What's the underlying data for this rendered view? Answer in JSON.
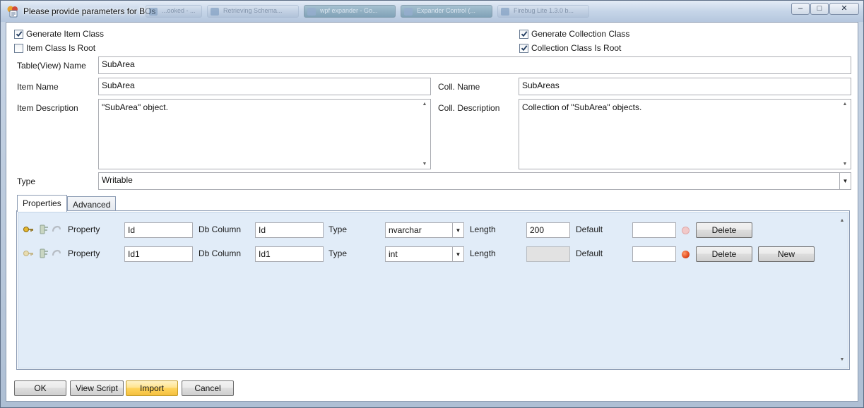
{
  "window": {
    "title": "Please provide parameters for BOs",
    "background_tabs": [
      "...ooked - ...",
      "Retrieving Schema...",
      "wpf expander - Go...",
      "Expander Control (...",
      "Firebug Lite 1.3.0 b..."
    ],
    "minimize": "–",
    "maximize": "□",
    "close": "✕"
  },
  "options": {
    "generate_item_class": {
      "label": "Generate Item Class",
      "checked": true
    },
    "item_class_is_root": {
      "label": "Item Class Is Root",
      "checked": false
    },
    "generate_collection_class": {
      "label": "Generate Collection Class",
      "checked": true
    },
    "collection_class_is_root": {
      "label": "Collection Class Is Root",
      "checked": true
    }
  },
  "form": {
    "table_name_label": "Table(View) Name",
    "table_name_value": "SubArea",
    "item_name_label": "Item Name",
    "item_name_value": "SubArea",
    "coll_name_label": "Coll. Name",
    "coll_name_value": "SubAreas",
    "item_description_label": "Item Description",
    "item_description_value": "\"SubArea\" object.",
    "coll_description_label": "Coll. Description",
    "coll_description_value": "Collection of \"SubArea\" objects.",
    "type_label": "Type",
    "type_value": "Writable"
  },
  "tabs": [
    {
      "label": "Properties",
      "active": true
    },
    {
      "label": "Advanced",
      "active": false
    }
  ],
  "properties_rows": [
    {
      "property_label": "Property",
      "property_value": "Id",
      "db_column_label": "Db Column",
      "db_column_value": "Id",
      "type_label": "Type",
      "type_value": "nvarchar",
      "length_label": "Length",
      "length_value": "200",
      "length_enabled": true,
      "default_label": "Default",
      "default_value": "",
      "status_color": "#f1c9c9",
      "delete_label": "Delete"
    },
    {
      "property_label": "Property",
      "property_value": "Id1",
      "db_column_label": "Db Column",
      "db_column_value": "Id1",
      "type_label": "Type",
      "type_value": "int",
      "length_label": "Length",
      "length_value": "",
      "length_enabled": false,
      "default_label": "Default",
      "default_value": "",
      "status_color": "#e14a1e",
      "delete_label": "Delete",
      "new_label": "New"
    }
  ],
  "footer": {
    "ok_label": "OK",
    "view_script_label": "View Script",
    "import_label": "Import",
    "cancel_label": "Cancel"
  },
  "colors": {
    "panel_background": "#e1ecf8",
    "primary_button": "#ffd45c",
    "window_chrome": "#c6d5e8"
  }
}
